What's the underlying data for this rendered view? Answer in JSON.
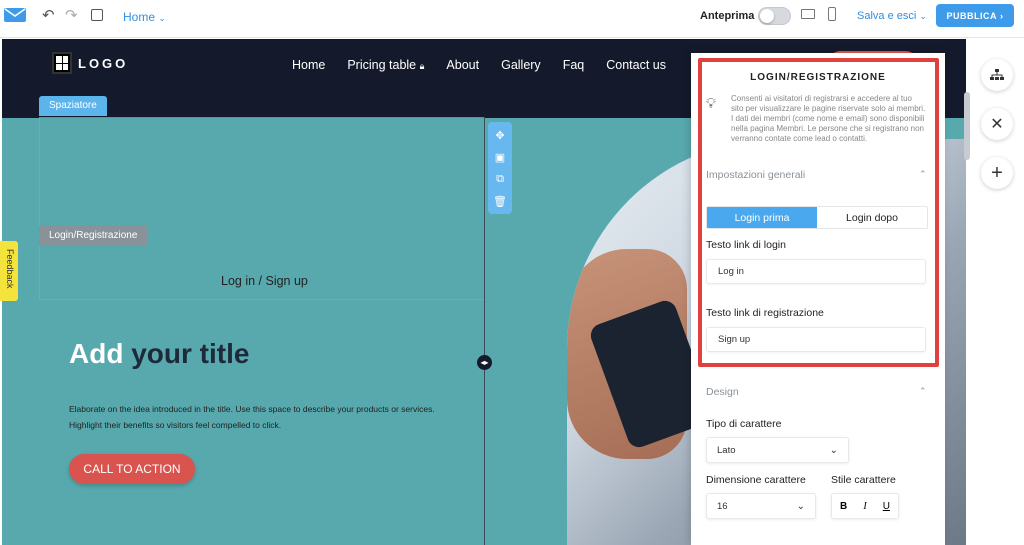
{
  "topbar": {
    "page_select": "Home",
    "preview_label": "Anteprima",
    "save_exit": "Salva e esci",
    "publish": "PUBBLICA"
  },
  "site": {
    "logo_text": "LOGO",
    "nav": [
      "Home",
      "Pricing table",
      "About",
      "Gallery",
      "Faq",
      "Contact us"
    ],
    "spacer_tag": "Spaziatore",
    "login_tag": "Login/Registrazione",
    "login_link": "Log in / Sign up",
    "title_part1": "Add",
    "title_part2": "your title",
    "description": "Elaborate on the idea introduced in the title. Use this space to describe your products or services. Highlight their benefits so visitors feel compelled to click.",
    "cta": "CALL TO ACTION",
    "feedback": "Feedback"
  },
  "panel": {
    "title": "LOGIN/REGISTRAZIONE",
    "info": "Consenti ai visitatori di registrarsi e accedere al tuo sito per visualizzare le pagine riservate solo ai membri. I dati dei membri (come nome e email) sono disponibili nella pagina Membri. Le persone che si registrano non verranno contate come lead o contatti.",
    "section_general": "Impostazioni generali",
    "tab_login_before": "Login prima",
    "tab_login_after": "Login dopo",
    "login_link_label": "Testo link di login",
    "login_link_value": "Log in",
    "signup_link_label": "Testo link di registrazione",
    "signup_link_value": "Sign up",
    "section_design": "Design",
    "font_label": "Tipo di carattere",
    "font_value": "Lato",
    "size_label": "Dimensione carattere",
    "size_value": "16",
    "style_label": "Stile carattere",
    "style_buttons": [
      "B",
      "I",
      "U"
    ]
  },
  "colors": {
    "accent": "#3d9be9",
    "canvas_bg": "#58a9ae",
    "navbar": "#141a2b",
    "cta": "#d9534f",
    "highlight_frame": "#e0413f"
  }
}
